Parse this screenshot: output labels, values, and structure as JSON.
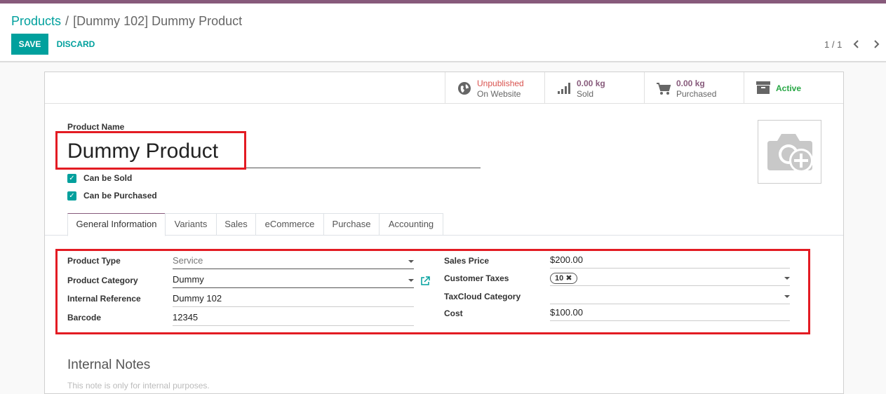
{
  "breadcrumb": {
    "parent": "Products",
    "separator": "/",
    "current": "[Dummy 102] Dummy Product"
  },
  "actions": {
    "save_label": "SAVE",
    "discard_label": "DISCARD"
  },
  "pager": {
    "value": "1 / 1"
  },
  "stat_buttons": {
    "website": {
      "value": "Unpublished",
      "label": "On Website",
      "icon": "globe-icon"
    },
    "sold": {
      "value": "0.00 kg",
      "label": "Sold",
      "icon": "bar-chart-icon"
    },
    "purchased": {
      "value": "0.00 kg",
      "label": "Purchased",
      "icon": "shopping-cart-icon"
    },
    "active": {
      "value": "Active",
      "icon": "archive-icon"
    }
  },
  "product": {
    "name_label": "Product Name",
    "name": "Dummy Product",
    "can_be_sold_label": "Can be Sold",
    "can_be_sold": true,
    "can_be_purchased_label": "Can be Purchased",
    "can_be_purchased": true
  },
  "tabs": [
    {
      "label": "General Information",
      "active": true
    },
    {
      "label": "Variants"
    },
    {
      "label": "Sales"
    },
    {
      "label": "eCommerce"
    },
    {
      "label": "Purchase"
    },
    {
      "label": "Accounting"
    }
  ],
  "general": {
    "product_type": {
      "label": "Product Type",
      "value": "Service"
    },
    "product_category": {
      "label": "Product Category",
      "value": "Dummy"
    },
    "internal_reference": {
      "label": "Internal Reference",
      "value": "Dummy 102"
    },
    "barcode": {
      "label": "Barcode",
      "value": "12345"
    },
    "sales_price": {
      "label": "Sales Price",
      "currency": "$",
      "value": "200.00"
    },
    "customer_taxes": {
      "label": "Customer Taxes",
      "tag": "10",
      "tag_remove": "✖"
    },
    "taxcloud_category": {
      "label": "TaxCloud Category",
      "value": ""
    },
    "cost": {
      "label": "Cost",
      "currency": "$",
      "value": "100.00"
    }
  },
  "notes": {
    "title": "Internal Notes",
    "placeholder": "This note is only for internal purposes."
  },
  "colors": {
    "brand": "#875a7b",
    "accent": "#00a09d",
    "highlight": "#e31b23",
    "active": "#28a745",
    "unpublished": "#d9534f"
  }
}
